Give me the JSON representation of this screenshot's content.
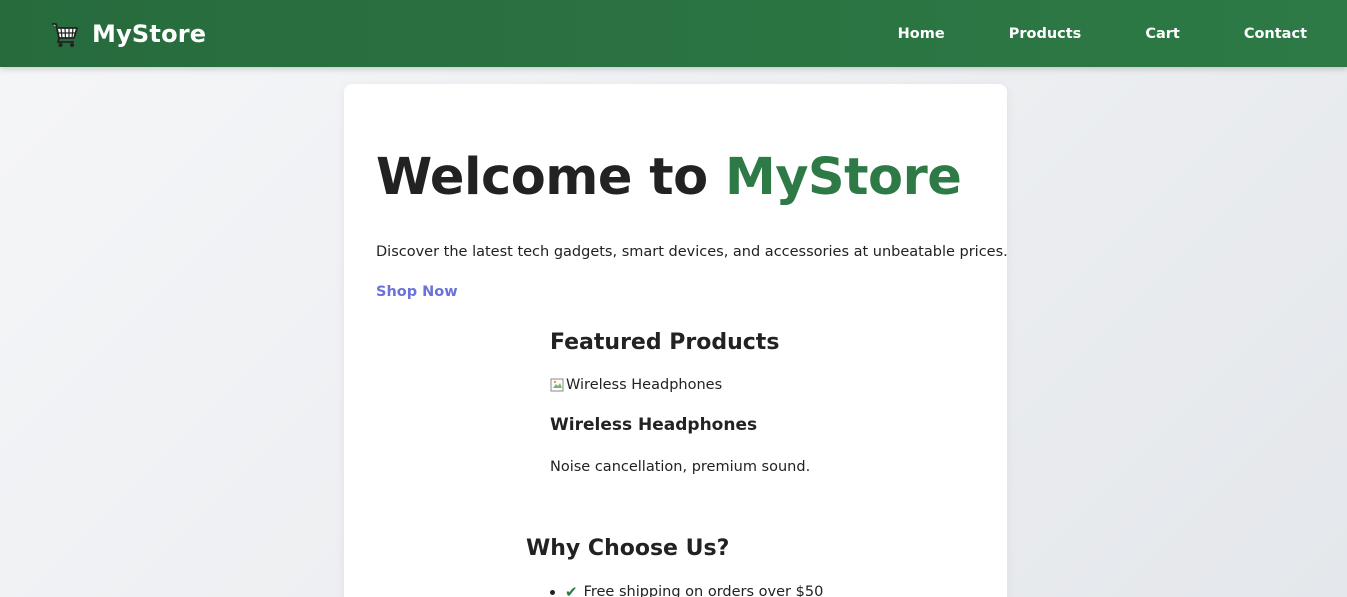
{
  "navbar": {
    "brand_icon": "shopping-cart-icon",
    "brand_name": "MyStore",
    "links": [
      "Home",
      "Products",
      "Cart",
      "Contact"
    ],
    "background": "#2d7a46"
  },
  "hero": {
    "title_prefix": "Welcome to ",
    "title_accent": "MyStore",
    "accent_color": "#2d7a46",
    "description": "Discover the latest tech gadgets, smart devices, and accessories at unbeatable prices.",
    "cta_label": "Shop Now",
    "cta_color": "#6b72d8"
  },
  "featured": {
    "heading": "Featured Products",
    "products": [
      {
        "image_alt": "Wireless Headphones",
        "name": "Wireless Headphones",
        "description": "Noise cancellation, premium sound."
      }
    ]
  },
  "why": {
    "heading": "Why Choose Us?",
    "items": [
      {
        "icon": "check-icon",
        "text": "Free shipping on orders over $50"
      }
    ]
  }
}
